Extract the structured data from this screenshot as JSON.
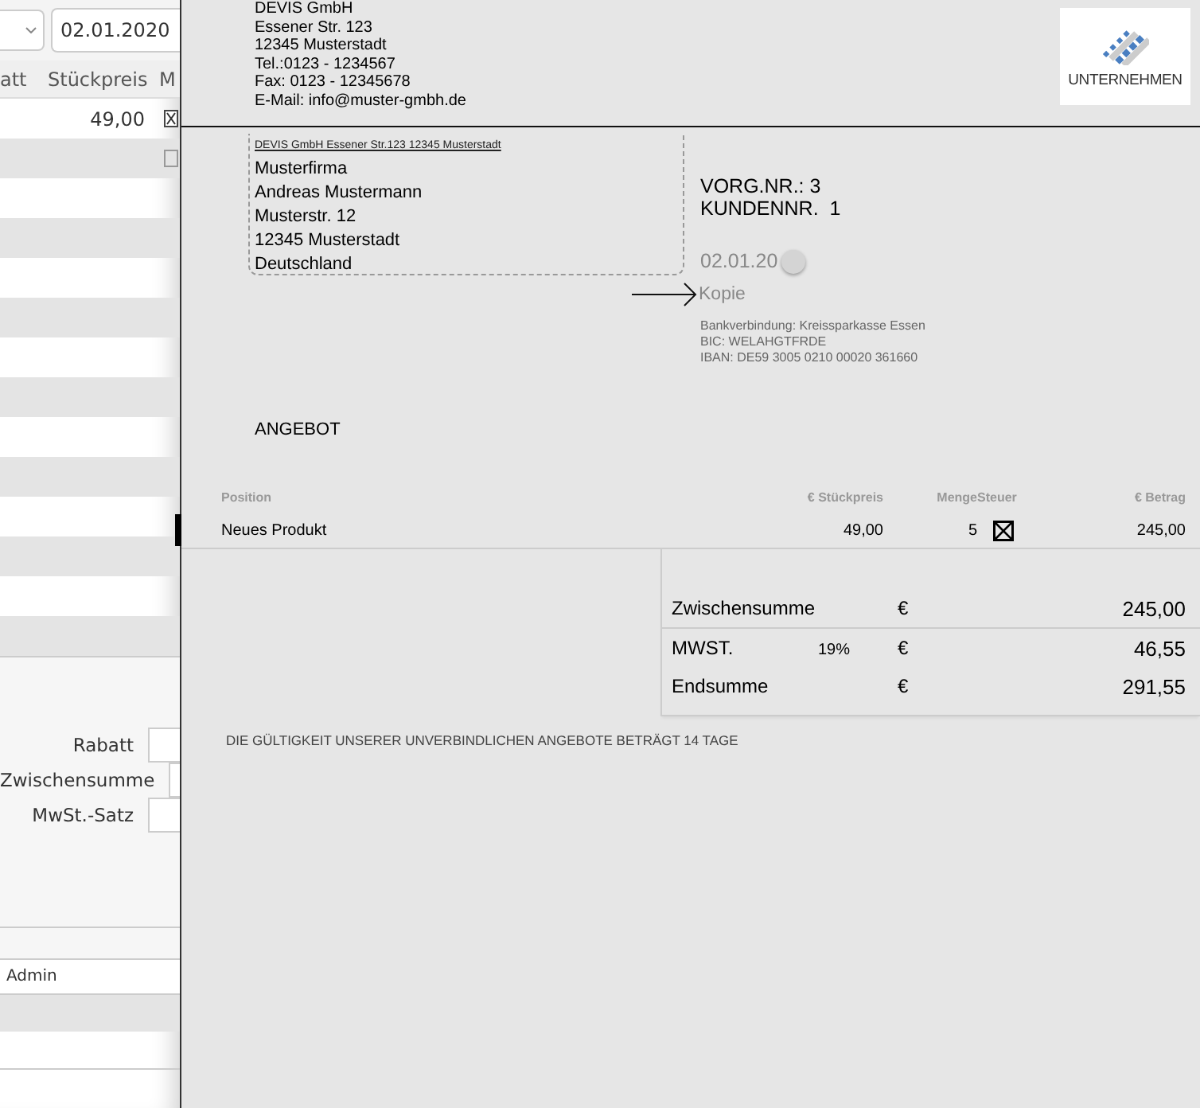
{
  "left_panel": {
    "date_field": {
      "value": "02.01.2020"
    },
    "columns": [
      "att",
      "Stückpreis",
      "M"
    ],
    "rows": [
      {
        "unit_price": "49,00",
        "checked": true
      },
      {
        "checked": false
      }
    ],
    "summary_labels": [
      "Rabatt",
      "Zwischensumme",
      "MwSt.-Satz"
    ],
    "user": "Admin"
  },
  "document": {
    "company_lines": [
      "DEVIS GmbH",
      "Essener Str. 123",
      "12345 Musterstadt",
      "Tel.:0123 - 1234567",
      "Fax: 0123 - 12345678",
      "E-Mail: info@muster-gmbh.de"
    ],
    "logo_text": "UNTERNEHMEN",
    "sender_line": "DEVIS GmbH Essener Str.123 12345 Musterstadt",
    "recipient_lines": [
      "Musterfirma",
      "Andreas Mustermann",
      "Musterstr. 12",
      "12345 Musterstadt",
      "Deutschland"
    ],
    "info_lines": [
      "VORG.NR.: 3",
      "KUNDENNR.  1"
    ],
    "date": "02.01.20",
    "copy_label": "Kopie",
    "bank_lines": [
      "Bankverbindung: Kreissparkasse Essen",
      "BIC: WELAHGTFRDE",
      "IBAN: DE59 3005 0210 00020 361660"
    ],
    "title": "ANGEBOT",
    "table": {
      "columns": [
        "Position",
        "€ Stückpreis",
        "Menge",
        "Steuer",
        "€ Betrag"
      ],
      "rows": [
        {
          "position": "Neues Produkt",
          "unit_price": "49,00",
          "quantity": "5",
          "taxed": true,
          "amount": "245,00"
        }
      ]
    },
    "totals": [
      {
        "label": "Zwischensumme",
        "currency": "€",
        "value": "245,00"
      },
      {
        "label": "MWST.",
        "rate": "19%",
        "currency": "€",
        "value": "46,55"
      },
      {
        "label": "Endsumme",
        "currency": "€",
        "value": "291,55"
      }
    ],
    "footer": "DIE GÜLTIGKEIT UNSERER UNVERBINDLICHEN ANGEBOTE BETRÄGT 14 TAGE"
  }
}
